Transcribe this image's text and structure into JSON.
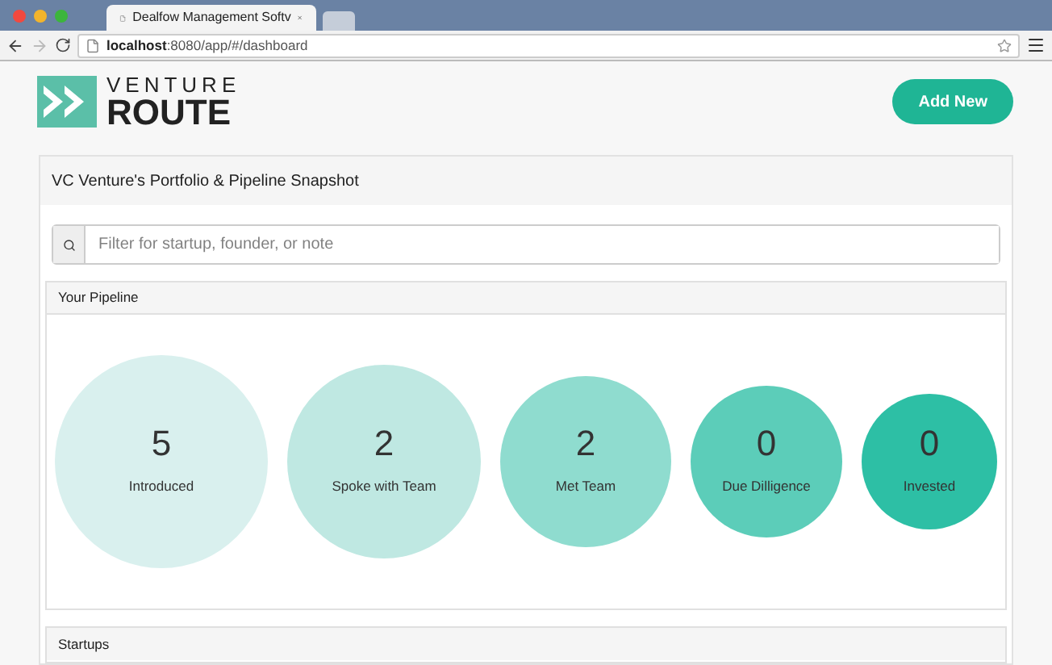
{
  "browser": {
    "tab_title": "Dealfow Management Softv",
    "url_host": "localhost",
    "url_path": ":8080/app/#/dashboard"
  },
  "header": {
    "logo_top": "VENTURE",
    "logo_bottom": "ROUTE",
    "button": "Add New"
  },
  "panel": {
    "title": "VC Venture's Portfolio & Pipeline Snapshot",
    "search": {
      "placeholder": "Filter for startup, founder, or note"
    },
    "pipeline": {
      "title": "Your Pipeline",
      "stages": [
        {
          "count": "5",
          "label": "Introduced",
          "color": "#d9f0ee"
        },
        {
          "count": "2",
          "label": "Spoke with Team",
          "color": "#bfe8e2"
        },
        {
          "count": "2",
          "label": "Met Team",
          "color": "#8fdccf"
        },
        {
          "count": "0",
          "label": "Due Dilligence",
          "color": "#5ccdb9"
        },
        {
          "count": "0",
          "label": "Invested",
          "color": "#2dbfa5"
        }
      ]
    },
    "startups": {
      "title": "Startups"
    }
  }
}
